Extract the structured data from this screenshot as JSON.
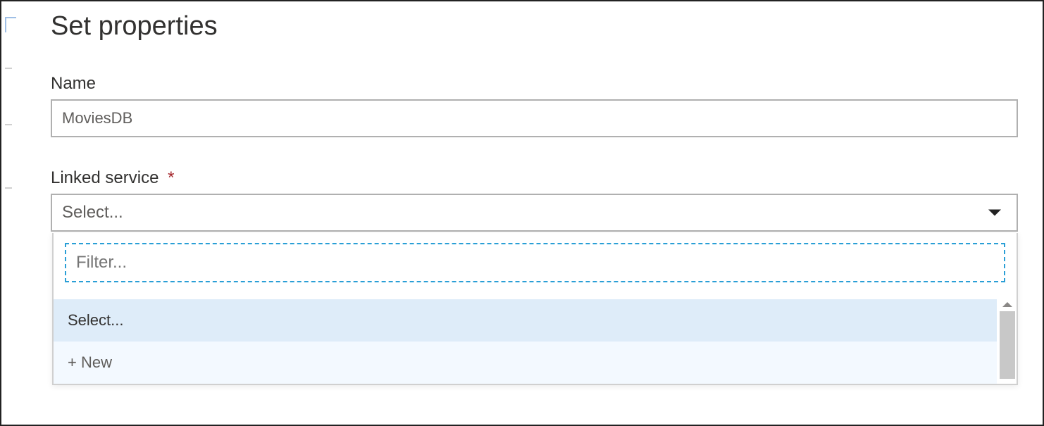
{
  "heading": "Set properties",
  "form": {
    "name": {
      "label": "Name",
      "value": "MoviesDB"
    },
    "linked_service": {
      "label": "Linked service",
      "required_mark": "*",
      "placeholder": "Select...",
      "dropdown": {
        "filter_placeholder": "Filter...",
        "options": [
          {
            "label": "Select...",
            "selected": true
          },
          {
            "label": "+ New",
            "selected": false
          }
        ]
      }
    }
  }
}
